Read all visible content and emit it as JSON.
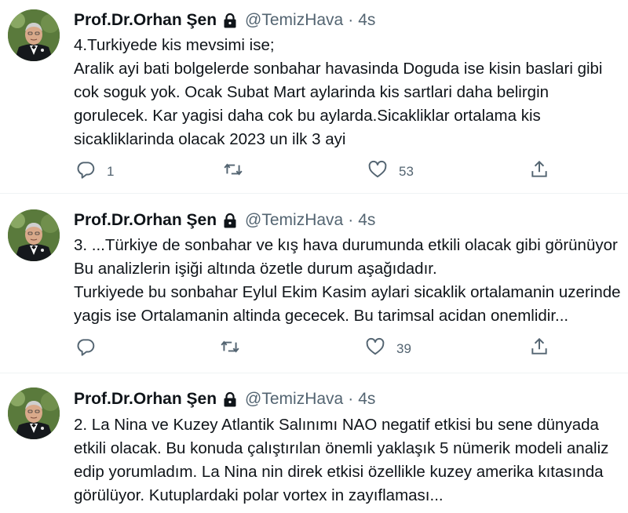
{
  "tweets": [
    {
      "name": "Prof.Dr.Orhan Şen",
      "handle": "@TemizHava",
      "dot": "·",
      "time": "4s",
      "lines": [
        "4.Turkiyede kis mevsimi ise;",
        "Aralik ayi bati bolgelerde sonbahar havasinda Doguda ise kisin baslari gibi",
        "cok soguk yok. Ocak Subat Mart aylarinda kis sartlari daha belirgin",
        "gorulecek. Kar yagisi daha cok bu aylarda.Sicakliklar ortalama kis",
        "sicakliklarinda olacak 2023 un ilk 3 ayi"
      ],
      "reply_count": "1",
      "retweet_count": "",
      "like_count": "53"
    },
    {
      "name": "Prof.Dr.Orhan Şen",
      "handle": "@TemizHava",
      "dot": "·",
      "time": "4s",
      "lines": [
        "3. ...Türkiye de sonbahar ve kış hava durumunda etkili olacak gibi görünüyor",
        "Bu analizlerin işiği altında özetle durum aşağıdadır.",
        "Turkiyede bu sonbahar Eylul Ekim Kasim aylari sicaklik ortalamanin uzerinde",
        "yagis ise Ortalamanin altinda gececek. Bu tarimsal acidan onemlidir..."
      ],
      "reply_count": "",
      "retweet_count": "",
      "like_count": "39"
    },
    {
      "name": "Prof.Dr.Orhan Şen",
      "handle": "@TemizHava",
      "dot": "·",
      "time": "4s",
      "lines": [
        "2. La Nina ve Kuzey Atlantik Salınımı NAO negatif etkisi bu sene dünyada",
        "etkili olacak. Bu konuda çalıştırılan önemli yaklaşık 5 nümerik modeli analiz",
        "edip yorumladım. La Nina nin direk etkisi özellikle kuzey amerika kıtasında",
        "görülüyor. Kutuplardaki polar vortex in zayıflaması..."
      ]
    }
  ],
  "icons": {
    "reply": "reply-icon",
    "retweet": "retweet-icon",
    "like": "heart-icon",
    "share": "share-icon",
    "lock": "lock-icon",
    "avatar": "avatar"
  },
  "colors": {
    "text": "#0f1419",
    "muted": "#536471",
    "separator": "#eff3f4"
  }
}
